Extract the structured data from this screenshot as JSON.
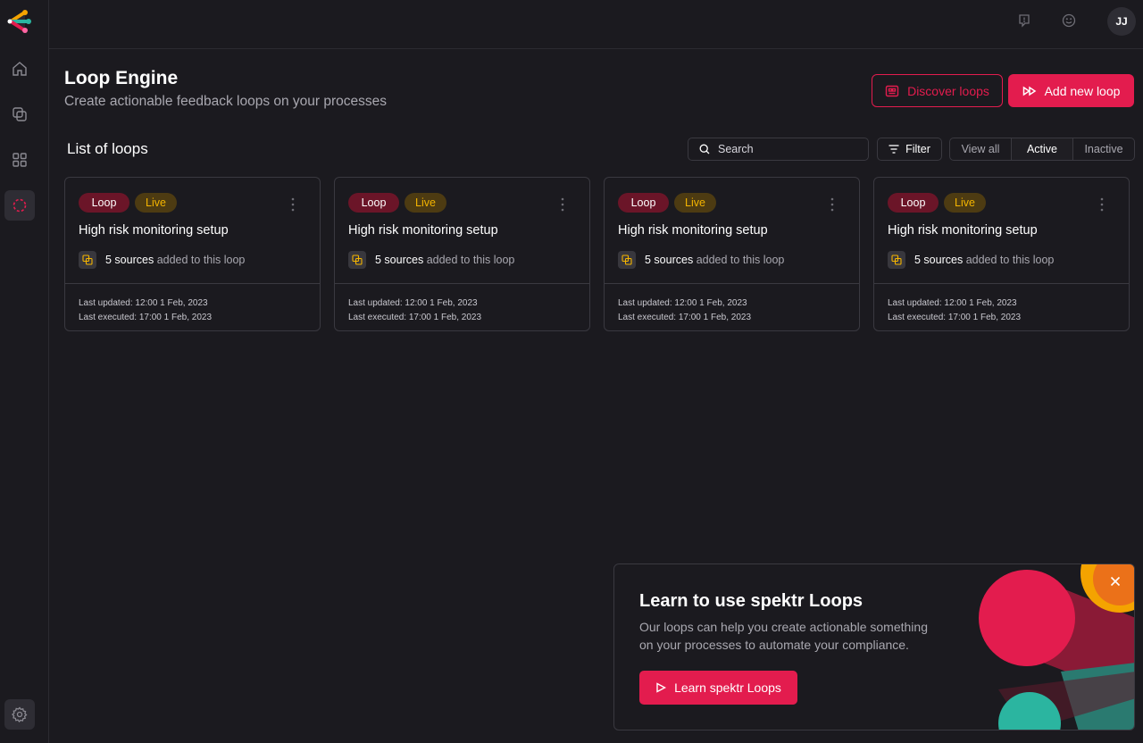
{
  "topbar": {
    "icons": [
      "message-alert-icon",
      "smiley-icon"
    ],
    "avatar_initials": "JJ"
  },
  "sidebar": {
    "items": [
      {
        "name": "home-icon"
      },
      {
        "name": "processes-icon"
      },
      {
        "name": "apps-grid-icon"
      },
      {
        "name": "loops-icon",
        "active": true
      }
    ],
    "settings_icon": "gear-icon"
  },
  "header": {
    "title": "Loop Engine",
    "subtitle": "Create actionable feedback loops on your processes",
    "discover_label": "Discover loops",
    "add_label": "Add new loop"
  },
  "list": {
    "title": "List of loops",
    "search_placeholder": "Search",
    "filter_label": "Filter",
    "segments": [
      "View all",
      "Active",
      "Inactive"
    ],
    "selected_segment": "Active"
  },
  "cards": [
    {
      "tag_type": "Loop",
      "tag_status": "Live",
      "title": "High risk monitoring setup",
      "sources_count": "5 sources",
      "sources_suffix": "added to this loop",
      "last_updated": "Last updated: 12:00 1 Feb, 2023",
      "last_executed": "Last executed: 17:00 1 Feb, 2023"
    },
    {
      "tag_type": "Loop",
      "tag_status": "Live",
      "title": "High risk monitoring setup",
      "sources_count": "5 sources",
      "sources_suffix": "added to this loop",
      "last_updated": "Last updated: 12:00 1 Feb, 2023",
      "last_executed": "Last executed: 17:00 1 Feb, 2023"
    },
    {
      "tag_type": "Loop",
      "tag_status": "Live",
      "title": "High risk monitoring setup",
      "sources_count": "5 sources",
      "sources_suffix": "added to this loop",
      "last_updated": "Last updated: 12:00 1 Feb, 2023",
      "last_executed": "Last executed: 17:00 1 Feb, 2023"
    },
    {
      "tag_type": "Loop",
      "tag_status": "Live",
      "title": "High risk monitoring setup",
      "sources_count": "5 sources",
      "sources_suffix": "added to this loop",
      "last_updated": "Last updated: 12:00 1 Feb, 2023",
      "last_executed": "Last executed: 17:00 1 Feb, 2023"
    }
  ],
  "promo": {
    "title": "Learn to use spektr Loops",
    "text": "Our loops can help you create actionable something on your processes to automate your compliance.",
    "button_label": "Learn spektr Loops"
  },
  "colors": {
    "background": "#1b1a1f",
    "accent": "#e31c4e",
    "border": "#3a3940",
    "loop_tag_bg": "#6b1528",
    "live_tag_bg": "#4d3b12",
    "live_tag_text": "#f4b400",
    "promo_teal": "#2bb5a0",
    "promo_orange": "#f4a300"
  }
}
